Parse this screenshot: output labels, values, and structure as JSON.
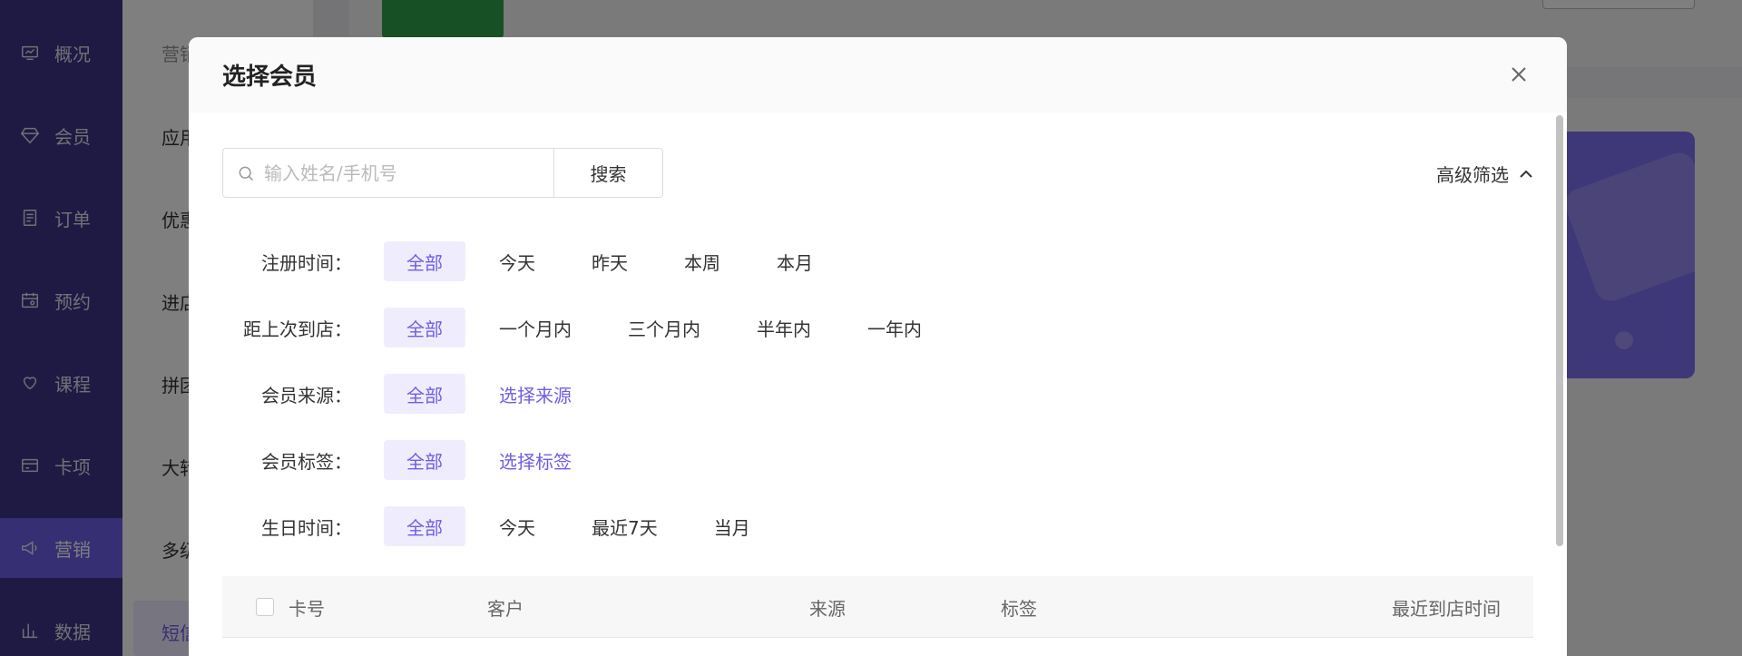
{
  "sidebar": {
    "items": [
      {
        "label": "概况",
        "icon": "monitor-icon"
      },
      {
        "label": "会员",
        "icon": "diamond-icon"
      },
      {
        "label": "订单",
        "icon": "document-icon"
      },
      {
        "label": "预约",
        "icon": "calendar-icon"
      },
      {
        "label": "课程",
        "icon": "heart-hand-icon"
      },
      {
        "label": "卡项",
        "icon": "card-icon"
      },
      {
        "label": "营销",
        "icon": "megaphone-icon"
      },
      {
        "label": "数据",
        "icon": "bar-chart-icon"
      }
    ],
    "active_index": 6
  },
  "subnav": {
    "header": "营销",
    "items": [
      "应用",
      "优惠",
      "进店",
      "拼团",
      "大转",
      "多级",
      "短信"
    ]
  },
  "modal": {
    "title": "选择会员",
    "search": {
      "placeholder": "输入姓名/手机号",
      "button": "搜索"
    },
    "advanced_filter": "高级筛选",
    "filters": [
      {
        "label": "注册时间：",
        "options": [
          "全部",
          "今天",
          "昨天",
          "本周",
          "本月"
        ],
        "active": 0
      },
      {
        "label": "距上次到店：",
        "options": [
          "全部",
          "一个月内",
          "三个月内",
          "半年内",
          "一年内"
        ],
        "active": 0
      },
      {
        "label": "会员来源：",
        "options": [
          "全部",
          "选择来源"
        ],
        "active": 0,
        "link": 1
      },
      {
        "label": "会员标签：",
        "options": [
          "全部",
          "选择标签"
        ],
        "active": 0,
        "link": 1
      },
      {
        "label": "生日时间：",
        "options": [
          "全部",
          "今天",
          "最近7天",
          "当月"
        ],
        "active": 0
      }
    ],
    "table": {
      "columns": [
        "卡号",
        "客户",
        "来源",
        "标签",
        "最近到店时间"
      ]
    }
  },
  "colors": {
    "accent": "#6f5ee6",
    "sidebar": "#3c3489",
    "chip_active_bg": "#efedfd"
  }
}
